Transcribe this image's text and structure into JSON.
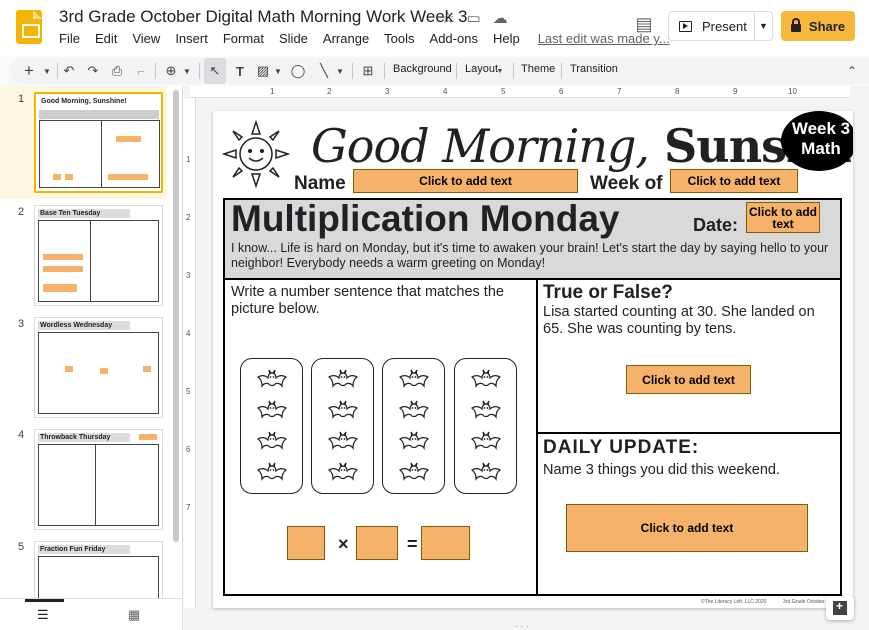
{
  "app": {
    "doc_title": "3rd Grade October Digital Math Morning Work Week 3",
    "menu": [
      "File",
      "Edit",
      "View",
      "Insert",
      "Format",
      "Slide",
      "Arrange",
      "Tools",
      "Add-ons",
      "Help"
    ],
    "last_edit": "Last edit was made y...",
    "present_label": "Present",
    "share_label": "Share"
  },
  "toolbar": {
    "background": "Background",
    "layout": "Layout",
    "theme": "Theme",
    "transition": "Transition"
  },
  "ruler": {
    "marks": [
      "1",
      "2",
      "3",
      "4",
      "5",
      "6",
      "7",
      "8",
      "9",
      "10"
    ],
    "vmarks": [
      "1",
      "2",
      "3",
      "4",
      "5",
      "6",
      "7"
    ]
  },
  "thumbnails": [
    {
      "num": "1",
      "title": "Good Morning, Sunshine!"
    },
    {
      "num": "2",
      "title": "Base Ten Tuesday"
    },
    {
      "num": "3",
      "title": "Wordless Wednesday"
    },
    {
      "num": "4",
      "title": "Throwback Thursday"
    },
    {
      "num": "5",
      "title": "Fraction Fun Friday"
    }
  ],
  "slide": {
    "title_script": "Good Morning,",
    "title_bold": "Sunshine!",
    "badge_line1": "Week 3",
    "badge_line2": "Math",
    "name_label": "Name",
    "week_label": "Week of",
    "placeholder": "Click to add text",
    "heading": "Multiplication Monday",
    "date_label": "Date:",
    "date_placeholder": "Click to add text",
    "intro": "I know... Life is hard on Monday, but it's time to awaken your brain! Let's start the day by saying hello to your neighbor! Everybody needs a warm greeting on Monday!",
    "left_prompt": "Write a number sentence that matches the picture below.",
    "tf_heading": "True or False?",
    "tf_text": "Lisa started counting at 30. She landed on 65. She was counting by tens.",
    "daily_heading": "DAILY UPDATE:",
    "daily_text": "Name 3 things you did this weekend.",
    "times": "×",
    "equals": "=",
    "footer_left": "©The Literacy Loft, LLC 2020",
    "footer_right": "3rd Grade October"
  },
  "colors": {
    "accent": "#f4b400",
    "share": "#f6b73c",
    "placeholder_fill": "#f6b26b",
    "banner": "#d9d9d9"
  }
}
